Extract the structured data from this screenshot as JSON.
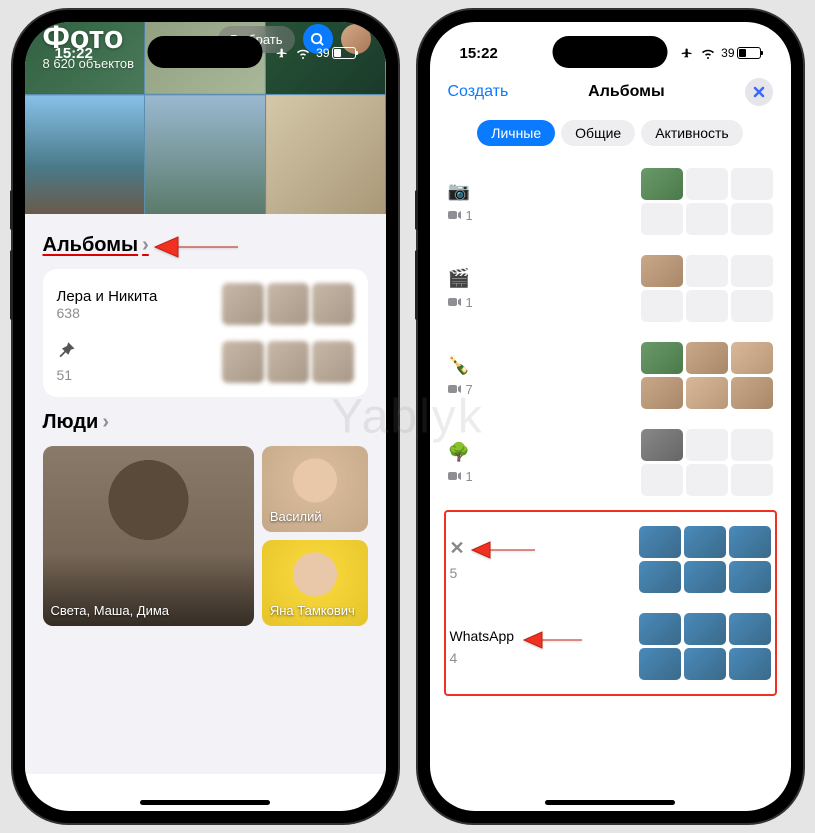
{
  "status": {
    "time": "15:22",
    "battery_pct": "39"
  },
  "left": {
    "title": "Фото",
    "subtitle": "8 620 объектов",
    "select_btn": "Выбрать",
    "albums_header": "Альбомы",
    "album1_name": "Лера и Никита",
    "album1_count": "638",
    "album2_count": "51",
    "people_header": "Люди",
    "person1": "Света, Маша, Дима",
    "person2": "Василий",
    "person3": "Яна Тамкович"
  },
  "right": {
    "create": "Создать",
    "title": "Альбомы",
    "tabs": {
      "personal": "Личные",
      "shared": "Общие",
      "activity": "Активность"
    },
    "rows": {
      "r1_count": "1",
      "r2_count": "1",
      "r3_count": "7",
      "r4_count": "1",
      "r5_count": "5",
      "r6_name": "WhatsApp",
      "r6_count": "4"
    }
  },
  "watermark": "Yablyk"
}
